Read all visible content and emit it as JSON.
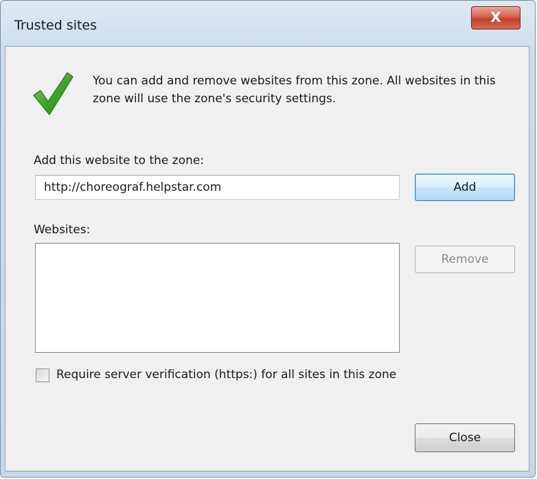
{
  "window": {
    "title": "Trusted sites",
    "close_glyph": "X"
  },
  "info": {
    "icon": "green-checkmark-icon",
    "text": "You can add and remove websites from this zone. All websites in this zone will use the zone's security settings."
  },
  "add_section": {
    "label": "Add this website to the zone:",
    "url_value": "http://choreograf.helpstar.com",
    "add_button": "Add"
  },
  "websites_section": {
    "label": "Websites:",
    "items": [],
    "remove_button": "Remove",
    "remove_enabled": false
  },
  "https_option": {
    "label": "Require server verification (https:) for all sites in this zone",
    "checked": false
  },
  "footer": {
    "close_button": "Close"
  },
  "colors": {
    "check_green": "#3fa82b",
    "close_red": "#c4402a",
    "default_button_border": "#3c7fb1"
  }
}
